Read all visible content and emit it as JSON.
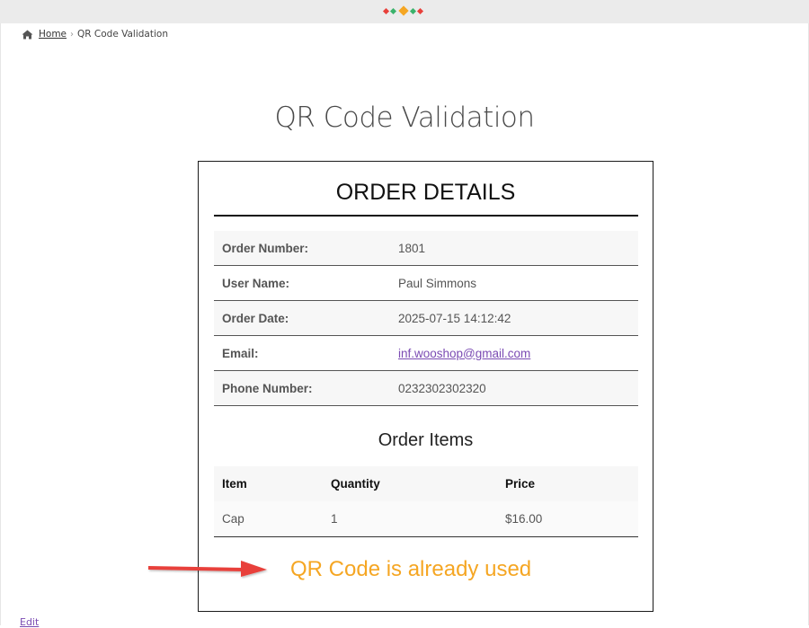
{
  "breadcrumb": {
    "home_label": "Home",
    "separator": "›",
    "current": "QR Code Validation"
  },
  "page": {
    "title": "QR Code Validation"
  },
  "card": {
    "title": "ORDER DETAILS",
    "details": [
      {
        "label": "Order Number:",
        "value": "1801"
      },
      {
        "label": "User Name:",
        "value": "Paul Simmons"
      },
      {
        "label": "Order Date:",
        "value": "2025-07-15 14:12:42"
      },
      {
        "label": "Email:",
        "value": "inf.wooshop@gmail.com"
      },
      {
        "label": "Phone Number:",
        "value": "0232302302320"
      }
    ],
    "items_title": "Order Items",
    "items_headers": [
      "Item",
      "Quantity",
      "Price"
    ],
    "items_rows": [
      [
        "Cap",
        "1",
        "$16.00"
      ]
    ],
    "status_message": "QR Code is already used"
  },
  "footer": {
    "edit_label": "Edit"
  },
  "colors": {
    "status": "#f5a623",
    "arrow": "#e8403a",
    "link": "#7b4bb3"
  },
  "icons": [
    "home-icon",
    "loading-dots-icon",
    "arrow-icon"
  ]
}
